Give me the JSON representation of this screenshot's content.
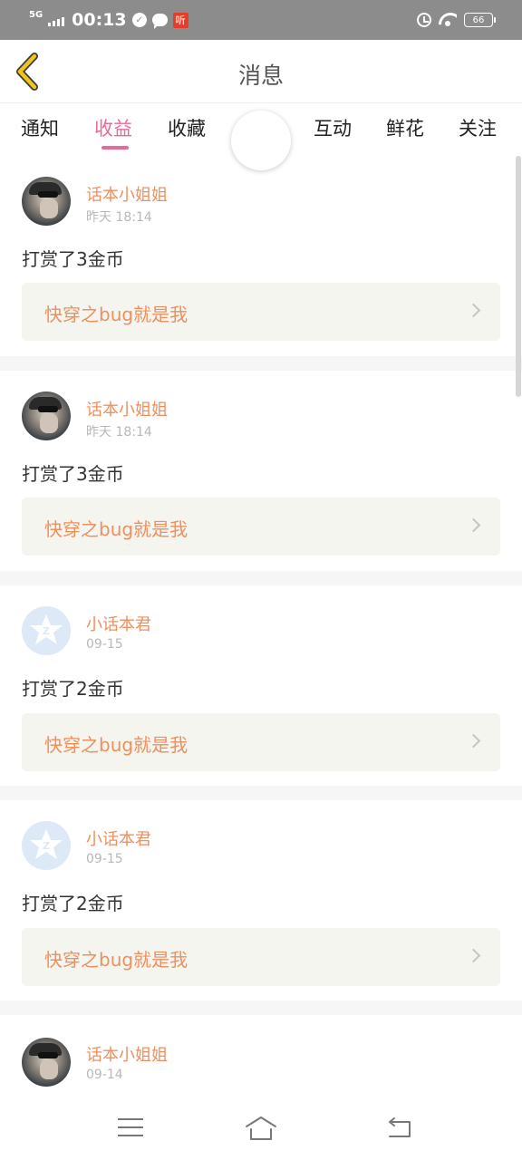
{
  "status_bar": {
    "network": "5G",
    "time": "00:13",
    "notif_badge": "听",
    "battery": "66"
  },
  "header": {
    "title": "消息"
  },
  "tabs": [
    {
      "label": "通知",
      "active": false
    },
    {
      "label": "收益",
      "active": true
    },
    {
      "label": "收藏",
      "active": false
    },
    {
      "label": "互动",
      "active": false
    },
    {
      "label": "鲜花",
      "active": false
    },
    {
      "label": "关注",
      "active": false
    }
  ],
  "messages": [
    {
      "user": "话本小姐姐",
      "time": "昨天 18:14",
      "text": "打赏了3金币",
      "book": "快穿之bug就是我",
      "avatar": "photo-avatar"
    },
    {
      "user": "话本小姐姐",
      "time": "昨天 18:14",
      "text": "打赏了3金币",
      "book": "快穿之bug就是我",
      "avatar": "photo-avatar"
    },
    {
      "user": "小话本君",
      "time": "09-15",
      "text": "打赏了2金币",
      "book": "快穿之bug就是我",
      "avatar": "default-avatar"
    },
    {
      "user": "小话本君",
      "time": "09-15",
      "text": "打赏了2金币",
      "book": "快穿之bug就是我",
      "avatar": "default-avatar"
    },
    {
      "user": "话本小姐姐",
      "time": "09-14",
      "avatar": "photo-avatar"
    }
  ],
  "colors": {
    "accent_pink": "#e66a9c",
    "username_orange": "#ee8f5e",
    "back_arrow": "#f0c419",
    "status_bar_bg": "#8c8c8c"
  },
  "icons": {
    "back": "chevron-left-icon",
    "row_arrow": "chevron-right-icon",
    "nav_menu": "menu-icon",
    "nav_home": "home-icon",
    "nav_back": "back-icon"
  }
}
